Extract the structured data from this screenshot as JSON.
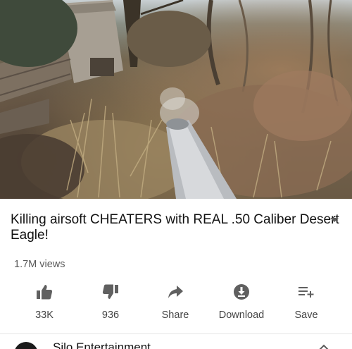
{
  "video": {
    "title": "Killing airsoft CHEATERS with REAL .50 Caliber Desert Eagle!",
    "views": "1.7M views"
  },
  "actions": {
    "like_label": "33K",
    "dislike_label": "936",
    "share_label": "Share",
    "download_label": "Download",
    "save_label": "Save"
  },
  "channel": {
    "name": "Silo Entertainment"
  },
  "colors": {
    "icon": "#606060",
    "text_secondary": "#5a5a5a",
    "divider": "#e6e6e6"
  },
  "icons": [
    "thumbs-up-icon",
    "thumbs-down-icon",
    "share-icon",
    "download-icon",
    "save-playlist-icon",
    "chevron-down-icon"
  ]
}
